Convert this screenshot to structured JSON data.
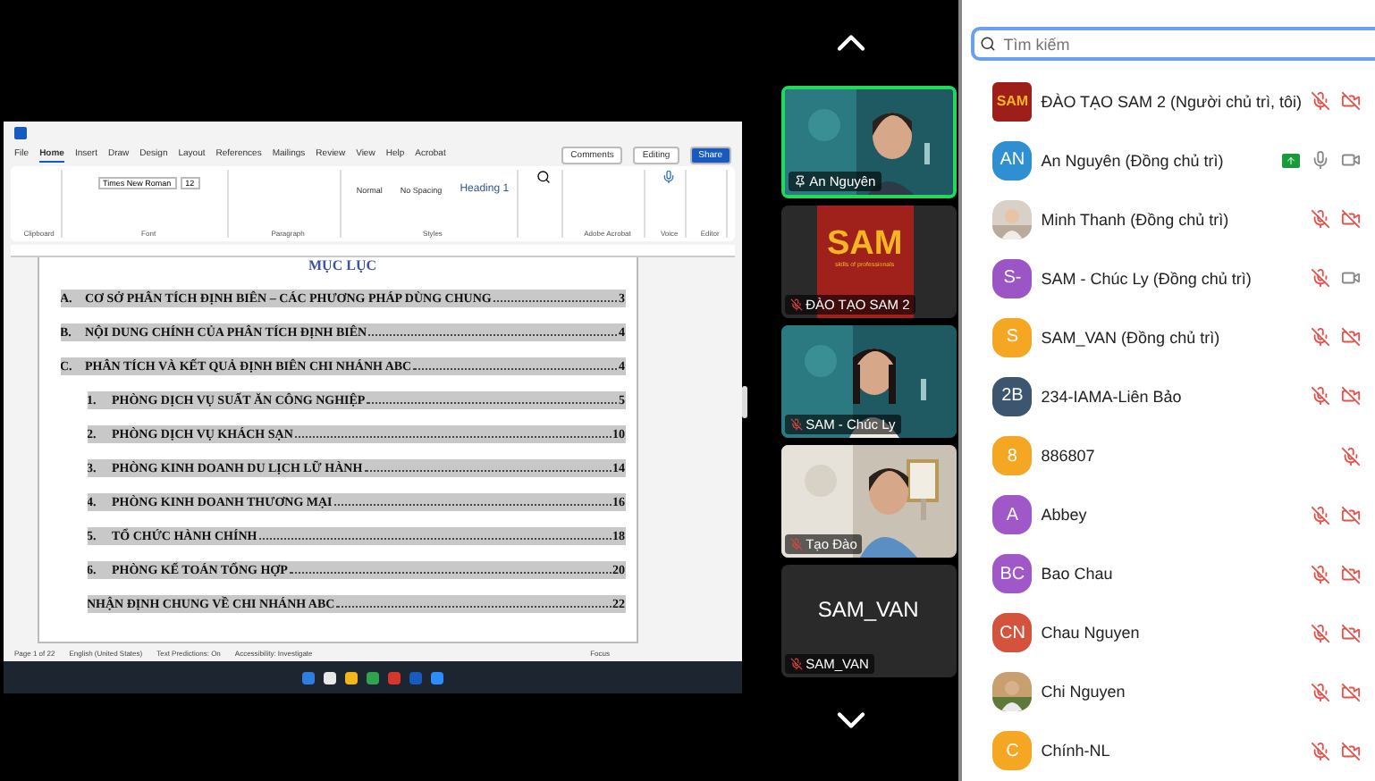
{
  "shared_screen": {
    "word": {
      "tabs": [
        {
          "label": "File",
          "selected": false
        },
        {
          "label": "Home",
          "selected": true
        },
        {
          "label": "Insert",
          "selected": false
        },
        {
          "label": "Draw",
          "selected": false
        },
        {
          "label": "Design",
          "selected": false
        },
        {
          "label": "Layout",
          "selected": false
        },
        {
          "label": "References",
          "selected": false
        },
        {
          "label": "Mailings",
          "selected": false
        },
        {
          "label": "Review",
          "selected": false
        },
        {
          "label": "View",
          "selected": false
        },
        {
          "label": "Help",
          "selected": false
        },
        {
          "label": "Acrobat",
          "selected": false
        }
      ],
      "actions": [
        "Comments",
        "Editing",
        "Share"
      ],
      "font": {
        "name": "Times New Roman",
        "size": "12"
      },
      "styles": [
        "Normal",
        "No Spacing",
        "Heading 1"
      ],
      "groups": [
        "Clipboard",
        "Font",
        "Paragraph",
        "Styles",
        "Adobe Acrobat",
        "Voice",
        "Editor"
      ],
      "status": [
        "Page 1 of 22",
        "English (United States)",
        "Text Predictions: On",
        "Accessibility: Investigate",
        "Focus"
      ]
    },
    "toc": {
      "title": "MỤC LỤC",
      "entries": [
        {
          "label": "A.",
          "text": "CƠ SỞ PHÂN TÍCH ĐỊNH BIÊN – CÁC PHƯƠNG PHÁP DÙNG CHUNG",
          "page": "3"
        },
        {
          "label": "B.",
          "text": "NỘI DUNG CHÍNH CỦA PHÂN TÍCH ĐỊNH BIÊN",
          "page": "4"
        },
        {
          "label": "C.",
          "text": "PHÂN TÍCH VÀ KẾT QUẢ ĐỊNH BIÊN CHI NHÁNH ABC",
          "page": "4",
          "children": [
            {
              "label": "1.",
              "text": "PHÒNG DỊCH VỤ SUẤT ĂN CÔNG NGHIỆP",
              "page": "5"
            },
            {
              "label": "2.",
              "text": "PHÒNG DỊCH VỤ KHÁCH SẠN",
              "page": "10"
            },
            {
              "label": "3.",
              "text": "PHÒNG KINH DOANH DU LỊCH LỮ HÀNH",
              "page": "14"
            },
            {
              "label": "4.",
              "text": "PHÒNG KINH DOANH THƯƠNG MẠI",
              "page": "16"
            },
            {
              "label": "5.",
              "text": "TỔ CHỨC HÀNH CHÍNH",
              "page": "18"
            },
            {
              "label": "6.",
              "text": "PHÒNG KẾ TOÁN TỔNG HỢP",
              "page": "20"
            },
            {
              "text": "NHẬN ĐỊNH CHUNG VỀ CHI NHÁNH ABC",
              "page": "22"
            }
          ]
        }
      ]
    }
  },
  "video_tiles": [
    {
      "name": "An Nguyên",
      "kind": "video",
      "speaking": true,
      "pinned": true,
      "muted": false
    },
    {
      "name": "ĐÀO TẠO SAM 2",
      "kind": "logo",
      "logo": "SAM",
      "tagline": "skills of professionals",
      "speaking": false,
      "pinned": false,
      "muted": true
    },
    {
      "name": "SAM - Chúc Ly",
      "kind": "video",
      "speaking": false,
      "pinned": false,
      "muted": true
    },
    {
      "name": "Tạo Đào",
      "kind": "video",
      "speaking": false,
      "pinned": false,
      "muted": true
    },
    {
      "name": "SAM_VAN",
      "kind": "name",
      "display_name": "SAM_VAN",
      "speaking": false,
      "pinned": false,
      "muted": true
    }
  ],
  "participants": {
    "search": {
      "placeholder": "Tìm kiếm"
    },
    "items": [
      {
        "name": "ĐÀO TẠO SAM 2 (Người chủ trì, tôi)",
        "kind": "logo",
        "avatar": "SAM",
        "muted": true,
        "video": {
          "off": true
        },
        "sharing": false
      },
      {
        "name": "An Nguyên (Đồng chủ trì)",
        "kind": "initials",
        "avatar": "AN",
        "color": "#2f8fd3",
        "muted": false,
        "video": {
          "off": false
        },
        "sharing": true
      },
      {
        "name": "Minh Thanh (Đồng chủ trì)",
        "muted": true,
        "video": {
          "off": true
        },
        "sharing": false
      },
      {
        "name": "SAM - Chúc Ly (Đồng chủ trì)",
        "kind": "initials",
        "avatar": "S-",
        "color": "#9b55c4",
        "muted": true,
        "video": {
          "off": false
        },
        "sharing": false
      },
      {
        "name": "SAM_VAN (Đồng chủ trì)",
        "kind": "initials",
        "avatar": "S",
        "color": "#f5a623",
        "muted": true,
        "video": {
          "off": true
        },
        "sharing": false
      },
      {
        "name": "234-IAMA-Liên Bảo",
        "kind": "initials",
        "avatar": "2B",
        "color": "#3b566e",
        "muted": true,
        "video": {
          "off": true
        },
        "sharing": false
      },
      {
        "name": "886807",
        "kind": "initials",
        "avatar": "8",
        "color": "#f5a623",
        "muted": true,
        "sharing": false
      },
      {
        "name": "Abbey",
        "kind": "initials",
        "avatar": "A",
        "color": "#a058c8",
        "muted": true,
        "video": {
          "off": true
        },
        "sharing": false
      },
      {
        "name": "Bao Chau",
        "kind": "initials",
        "avatar": "BC",
        "color": "#a058c8",
        "muted": true,
        "video": {
          "off": true
        },
        "sharing": false
      },
      {
        "name": "Chau Nguyen",
        "kind": "initials",
        "avatar": "CN",
        "color": "#d4533d",
        "muted": true,
        "video": {
          "off": true
        },
        "sharing": false
      },
      {
        "name": "Chi Nguyen",
        "muted": true,
        "video": {
          "off": true
        },
        "sharing": false
      },
      {
        "name": "Chính-NL",
        "kind": "initials",
        "avatar": "C",
        "color": "#f5a623",
        "muted": true,
        "video": {
          "off": true
        },
        "sharing": false
      }
    ]
  }
}
